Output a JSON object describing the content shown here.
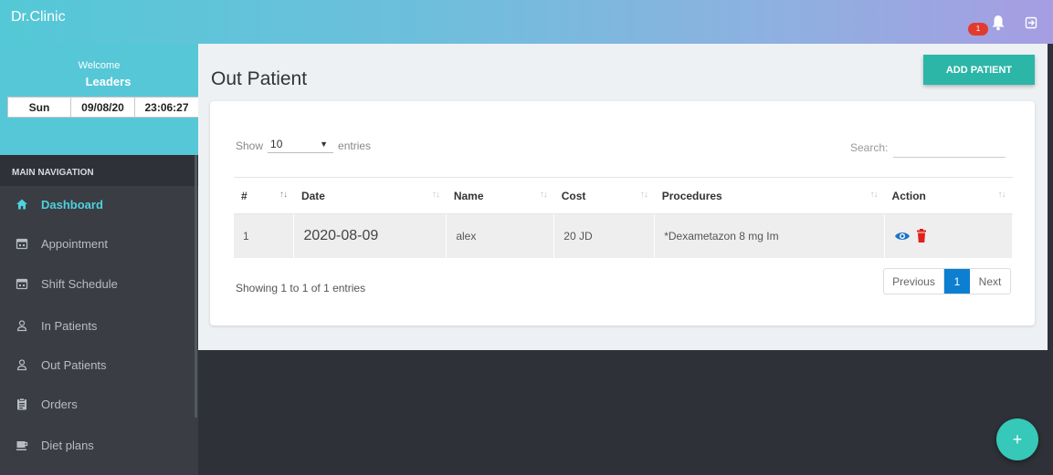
{
  "app": {
    "brand": "Dr.Clinic",
    "notification_count": "1"
  },
  "user": {
    "welcome": "Welcome",
    "name": "Leaders"
  },
  "clock": {
    "day": "Sun",
    "date": "09/08/20",
    "time": "23:06:27"
  },
  "nav": {
    "header": "MAIN NAVIGATION",
    "items": [
      {
        "label": "Dashboard",
        "icon": "home-icon",
        "active": true
      },
      {
        "label": "Appointment",
        "icon": "calendar-icon",
        "active": false
      },
      {
        "label": "Shift Schedule",
        "icon": "calendar-icon",
        "active": false
      },
      {
        "label": "In Patients",
        "icon": "person-icon",
        "active": false
      },
      {
        "label": "Out Patients",
        "icon": "person-icon",
        "active": false
      },
      {
        "label": "Orders",
        "icon": "clipboard-icon",
        "active": false
      },
      {
        "label": "Diet plans",
        "icon": "cup-icon",
        "active": false
      }
    ]
  },
  "page": {
    "title": "Out Patient",
    "add_button": "ADD PATIENT"
  },
  "table_controls": {
    "show_label": "Show",
    "entries_value": "10",
    "entries_label": "entries",
    "search_label": "Search:"
  },
  "table": {
    "columns": [
      "#",
      "Date",
      "Name",
      "Cost",
      "Procedures",
      "Action"
    ],
    "rows": [
      {
        "num": "1",
        "date": "2020-08-09",
        "name": "alex",
        "cost": "20 JD",
        "procedures": "*Dexametazon 8 mg Im"
      }
    ]
  },
  "footer": {
    "info": "Showing 1 to 1 of 1 entries",
    "previous": "Previous",
    "page": "1",
    "next": "Next"
  },
  "fab": {
    "label": "+"
  },
  "colors": {
    "accent": "#56c7d6",
    "primary_button": "#2bb6a7",
    "pager_active": "#0d7fd1",
    "delete": "#e0201a",
    "view": "#1a73c8"
  }
}
